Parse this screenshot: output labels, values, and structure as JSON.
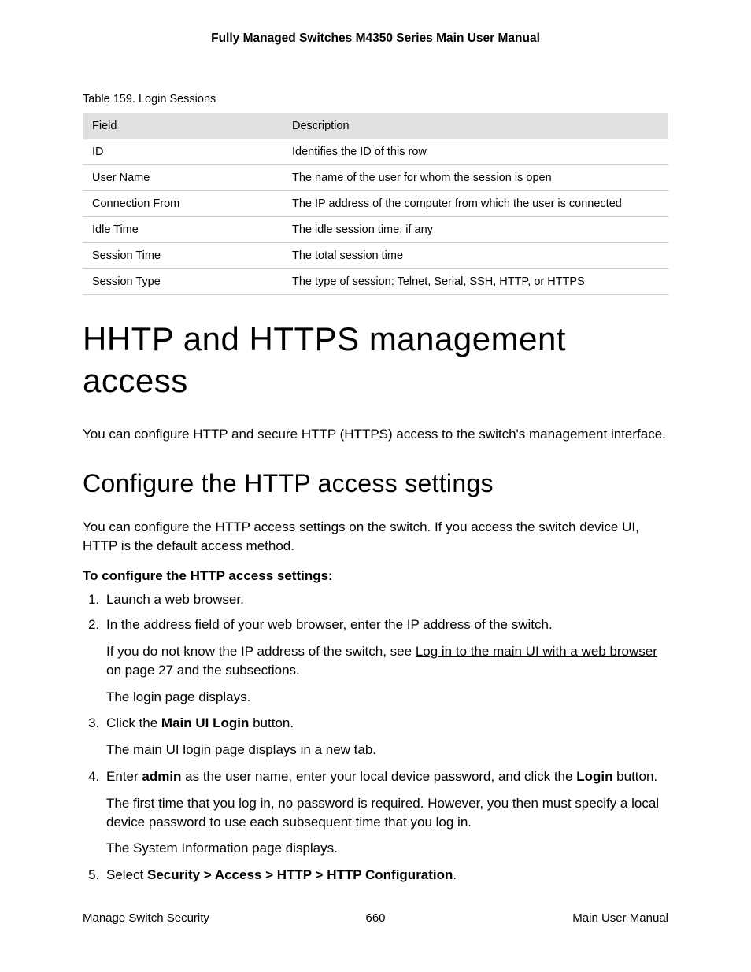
{
  "header": "Fully Managed Switches M4350 Series Main User Manual",
  "table": {
    "caption": "Table 159. Login Sessions",
    "cols": [
      "Field",
      "Description"
    ],
    "rows": [
      [
        "ID",
        "Identifies the ID of this row"
      ],
      [
        "User Name",
        "The name of the user for whom the session is open"
      ],
      [
        "Connection From",
        "The IP address of the computer from which the user is connected"
      ],
      [
        "Idle Time",
        "The idle session time, if any"
      ],
      [
        "Session Time",
        "The total session time"
      ],
      [
        "Session Type",
        "The type of session: Telnet, Serial, SSH, HTTP, or HTTPS"
      ]
    ]
  },
  "h1": "HHTP and HTTPS management access",
  "intro": "You can configure HTTP and secure HTTP (HTTPS) access to the switch's management interface.",
  "h2": "Configure the HTTP access settings",
  "sub_intro": "You can configure the HTTP access settings on the switch. If you access the switch device UI, HTTP is the default access method.",
  "steps_title": "To configure the HTTP access settings:",
  "steps": {
    "s1": "Launch a web browser.",
    "s2": "In the address field of your web browser, enter the IP address of the switch.",
    "s2a_pre": "If you do not know the IP address of the switch, see ",
    "s2a_link": "Log in to the main UI with a web browser",
    "s2a_post": " on page 27 and the subsections.",
    "s2b": "The login page displays.",
    "s3_pre": "Click the ",
    "s3_bold": "Main UI Login",
    "s3_post": " button.",
    "s3a": "The main UI login page displays in a new tab.",
    "s4_pre": "Enter ",
    "s4_bold1": "admin",
    "s4_mid": " as the user name, enter your local device password, and click the ",
    "s4_bold2": "Login",
    "s4_post": " button.",
    "s4a": "The first time that you log in, no password is required. However, you then must specify a local device password to use each subsequent time that you log in.",
    "s4b": "The System Information page displays.",
    "s5_pre": "Select ",
    "s5_bold": "Security > Access > HTTP > HTTP Configuration",
    "s5_post": "."
  },
  "footer": {
    "left": "Manage Switch Security",
    "center": "660",
    "right": "Main User Manual"
  }
}
